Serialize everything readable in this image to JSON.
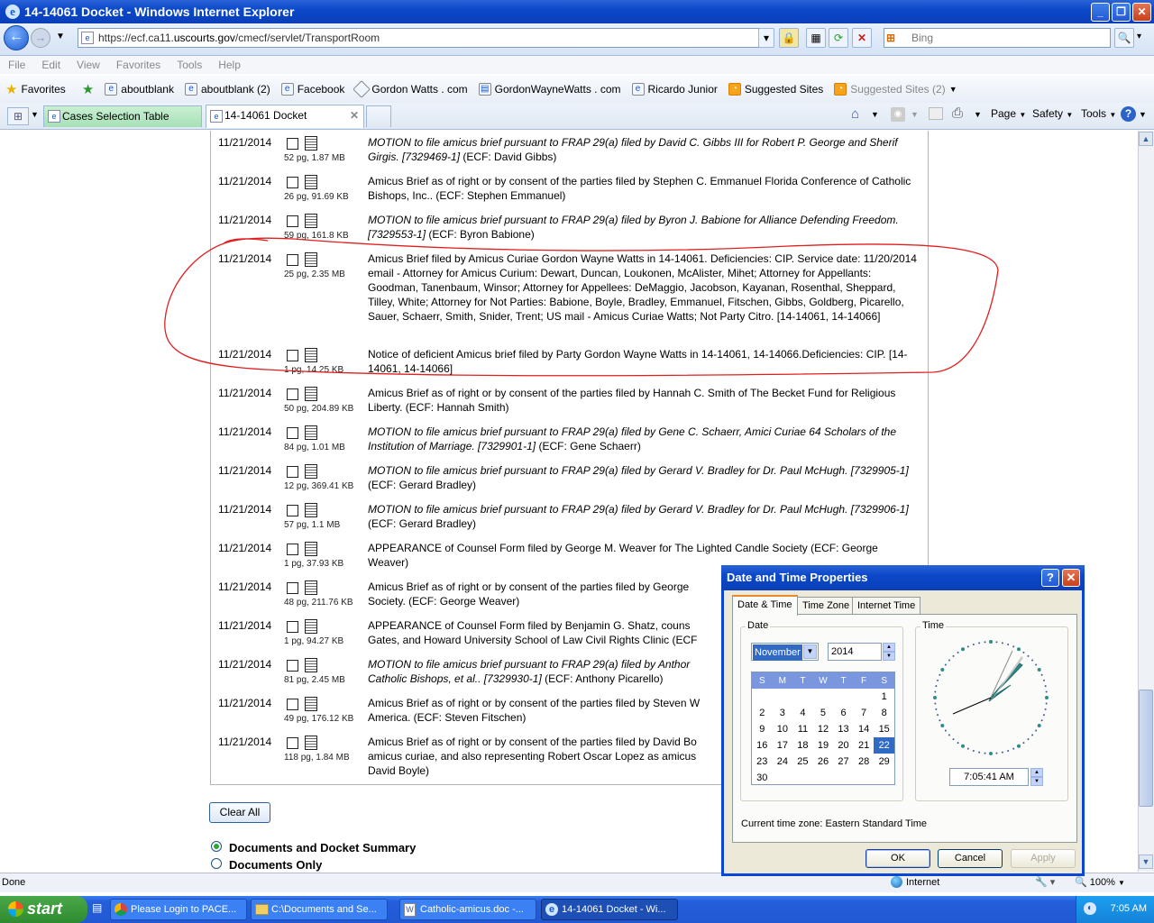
{
  "window": {
    "title": "14-14061 Docket - Windows Internet Explorer"
  },
  "address": {
    "url_prefix": "https://ecf.ca11.",
    "url_domain": "uscourts.gov",
    "url_path": "/cmecf/servlet/TransportRoom",
    "search_placeholder": "Bing"
  },
  "menu": [
    "File",
    "Edit",
    "View",
    "Favorites",
    "Tools",
    "Help"
  ],
  "favorites": {
    "label": "Favorites",
    "items": [
      "aboutblank",
      "aboutblank (2)",
      "Facebook",
      "Gordon Watts . com",
      "GordonWayneWatts . com",
      "Ricardo Junior",
      "Suggested Sites",
      "Suggested Sites (2)"
    ]
  },
  "tabs": [
    {
      "label": "Cases Selection Table"
    },
    {
      "label": "14-14061 Docket"
    }
  ],
  "commandbar": {
    "page": "Page",
    "safety": "Safety",
    "tools": "Tools"
  },
  "docket": [
    {
      "date": "11/21/2014",
      "size": "52 pg, 1.87 MB",
      "italic": true,
      "desc": "MOTION to file amicus brief pursuant to FRAP 29(a) filed by David C. Gibbs III for Robert P. George and Sherif Girgis. [7329469-1]",
      "tail": " (ECF: David Gibbs)"
    },
    {
      "date": "11/21/2014",
      "size": "26 pg, 91.69 KB",
      "italic": false,
      "desc": "Amicus Brief as of right or by consent of the parties filed by Stephen C. Emmanuel Florida Conference of Catholic Bishops, Inc.. (ECF: Stephen Emmanuel)",
      "tail": ""
    },
    {
      "date": "11/21/2014",
      "size": "59 pg, 161.8 KB",
      "italic": true,
      "desc": "MOTION to file amicus brief pursuant to FRAP 29(a) filed by Byron J. Babione for Alliance Defending Freedom. [7329553-1]",
      "tail": " (ECF: Byron Babione)"
    },
    {
      "date": "11/21/2014",
      "size": "25 pg, 2.35 MB",
      "italic": false,
      "desc": "Amicus Brief filed by Amicus Curiae Gordon Wayne Watts in 14-14061. Deficiencies: CIP. Service date: 11/20/2014 email - Attorney for Amicus Curium: Dewart, Duncan, Loukonen, McAlister, Mihet; Attorney for Appellants: Goodman, Tanenbaum, Winsor; Attorney for Appellees: DeMaggio, Jacobson, Kayanan, Rosenthal, Sheppard, Tilley, White; Attorney for Not Parties: Babione, Boyle, Bradley, Emmanuel, Fitschen, Gibbs, Goldberg, Picarello, Sauer, Schaerr, Smith, Snider, Trent; US mail - Amicus Curiae Watts; Not Party Citro. [14-14061, 14-14066]",
      "tail": ""
    },
    {
      "date": "11/21/2014",
      "size": "1 pg, 14.25 KB",
      "italic": false,
      "desc": "Notice of deficient Amicus brief filed by Party Gordon Wayne Watts in 14-14061, 14-14066.Deficiencies: CIP. [14-14061, 14-14066]",
      "tail": ""
    },
    {
      "date": "11/21/2014",
      "size": "50 pg, 204.89 KB",
      "italic": false,
      "desc": "Amicus Brief as of right or by consent of the parties filed by Hannah C. Smith of The Becket Fund for Religious Liberty. (ECF: Hannah Smith)",
      "tail": ""
    },
    {
      "date": "11/21/2014",
      "size": "84 pg, 1.01 MB",
      "italic": true,
      "desc": "MOTION to file amicus brief pursuant to FRAP 29(a) filed by Gene C. Schaerr, Amici Curiae 64 Scholars of the Institution of Marriage. [7329901-1]",
      "tail": " (ECF: Gene Schaerr)"
    },
    {
      "date": "11/21/2014",
      "size": "12 pg, 369.41 KB",
      "italic": true,
      "desc": "MOTION to file amicus brief pursuant to FRAP 29(a) filed by Gerard V. Bradley for Dr. Paul McHugh. [7329905-1]",
      "tail": " (ECF: Gerard Bradley)"
    },
    {
      "date": "11/21/2014",
      "size": "57 pg, 1.1 MB",
      "italic": true,
      "desc": "MOTION to file amicus brief pursuant to FRAP 29(a) filed by Gerard V. Bradley for Dr. Paul McHugh. [7329906-1]",
      "tail": " (ECF: Gerard Bradley)"
    },
    {
      "date": "11/21/2014",
      "size": "1 pg, 37.93 KB",
      "italic": false,
      "desc": "APPEARANCE of Counsel Form filed by George M. Weaver for The Lighted Candle Society (ECF: George Weaver)",
      "tail": ""
    },
    {
      "date": "11/21/2014",
      "size": "48 pg, 211.76 KB",
      "italic": false,
      "desc": "Amicus Brief as of right or by consent of the parties filed by George",
      "desc2": "Society. (ECF: George Weaver)",
      "tail": ""
    },
    {
      "date": "11/21/2014",
      "size": "1 pg, 94.27 KB",
      "italic": false,
      "desc": "APPEARANCE of Counsel Form filed by Benjamin G. Shatz, couns",
      "desc2": "Gates, and Howard University School of Law Civil Rights Clinic (ECF",
      "tail": ""
    },
    {
      "date": "11/21/2014",
      "size": "81 pg, 2.45 MB",
      "italic": true,
      "desc": "MOTION to file amicus brief pursuant to FRAP 29(a) filed by Anthor",
      "desc2": "Catholic Bishops, et al.. [7329930-1]",
      "tail": " (ECF: Anthony Picarello)"
    },
    {
      "date": "11/21/2014",
      "size": "49 pg, 176.12 KB",
      "italic": false,
      "desc": "Amicus Brief as of right or by consent of the parties filed by Steven W",
      "desc2": "America. (ECF: Steven Fitschen)",
      "tail": ""
    },
    {
      "date": "11/21/2014",
      "size": "118 pg, 1.84 MB",
      "italic": false,
      "desc": "Amicus Brief as of right or by consent of the parties filed by David Bo",
      "desc2": "amicus curiae, and also representing Robert Oscar Lopez as amicus",
      "desc3": "David Boyle)",
      "tail": ""
    }
  ],
  "controls": {
    "clear_all": "Clear All",
    "radio1": "Documents and Docket Summary",
    "radio2": "Documents Only"
  },
  "status": {
    "left": "Done",
    "zone": "Internet",
    "zoom": "100%"
  },
  "taskbar": {
    "start": "start",
    "items": [
      "Please Login to PACE...",
      "C:\\Documents and Se...",
      "Catholic-amicus.doc -...",
      "14-14061 Docket - Wi..."
    ],
    "clock": "7:05 AM"
  },
  "dialog": {
    "title": "Date and Time Properties",
    "tabs": [
      "Date & Time",
      "Time Zone",
      "Internet Time"
    ],
    "date_label": "Date",
    "time_label": "Time",
    "month": "November",
    "year": "2014",
    "weekdays": [
      "S",
      "M",
      "T",
      "W",
      "T",
      "F",
      "S"
    ],
    "weeks": [
      [
        "",
        "",
        "",
        "",
        "",
        "",
        "1"
      ],
      [
        "2",
        "3",
        "4",
        "5",
        "6",
        "7",
        "8"
      ],
      [
        "9",
        "10",
        "11",
        "12",
        "13",
        "14",
        "15"
      ],
      [
        "16",
        "17",
        "18",
        "19",
        "20",
        "21",
        "22"
      ],
      [
        "23",
        "24",
        "25",
        "26",
        "27",
        "28",
        "29"
      ],
      [
        "30",
        "",
        "",
        "",
        "",
        "",
        ""
      ]
    ],
    "selected_day": "22",
    "time": "7:05:41 AM",
    "timezone_label": "Current time zone:",
    "timezone": "Eastern Standard Time",
    "ok": "OK",
    "cancel": "Cancel",
    "apply": "Apply"
  }
}
